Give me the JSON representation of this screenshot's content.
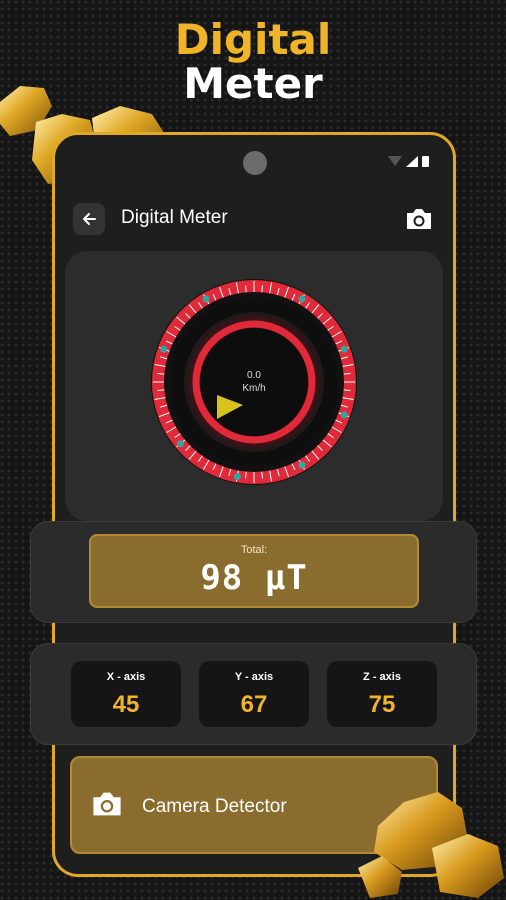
{
  "promo": {
    "line1": "Digital",
    "line2": "Meter"
  },
  "app_bar": {
    "title": "Digital Meter"
  },
  "gauge": {
    "speed": "0.0",
    "unit": "Km/h"
  },
  "total": {
    "label": "Total:",
    "value": "98 μT"
  },
  "axes": [
    {
      "label": "X - axis",
      "value": "45"
    },
    {
      "label": "Y - axis",
      "value": "67"
    },
    {
      "label": "Z - axis",
      "value": "75"
    }
  ],
  "camera_detector": {
    "label": "Camera Detector"
  },
  "colors": {
    "accent": "#f0b429",
    "card_gold": "#8a6d2e",
    "gauge_red": "#e02a3a",
    "gauge_teal": "#2fa7a0"
  },
  "icons": [
    "back-arrow-icon",
    "camera-icon",
    "wifi-icon",
    "signal-icon",
    "battery-icon",
    "gold-nugget-icon"
  ]
}
